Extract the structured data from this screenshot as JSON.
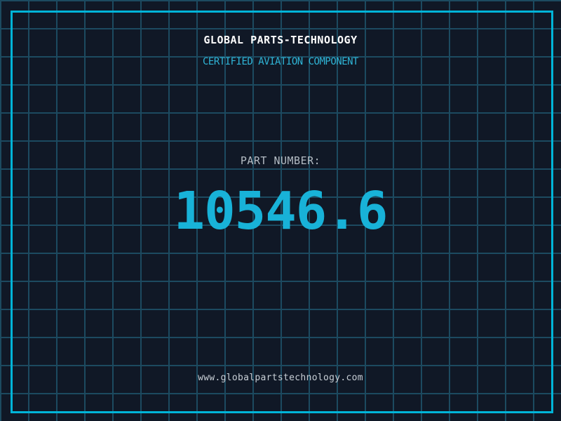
{
  "colors": {
    "background": "#101826",
    "grid_line": "#1c4a60",
    "frame_border": "#00b4d8",
    "title": "#ffffff",
    "subtitle": "#2fb4d6",
    "part_label": "#b4bcc4",
    "part_number": "#18b2d8",
    "url": "#c8cfd6"
  },
  "header": {
    "title": "GLOBAL PARTS-TECHNOLOGY",
    "subtitle": "CERTIFIED AVIATION COMPONENT"
  },
  "part": {
    "label": "PART NUMBER:",
    "number": "10546.6"
  },
  "footer": {
    "url": "www.globalpartstechnology.com"
  }
}
